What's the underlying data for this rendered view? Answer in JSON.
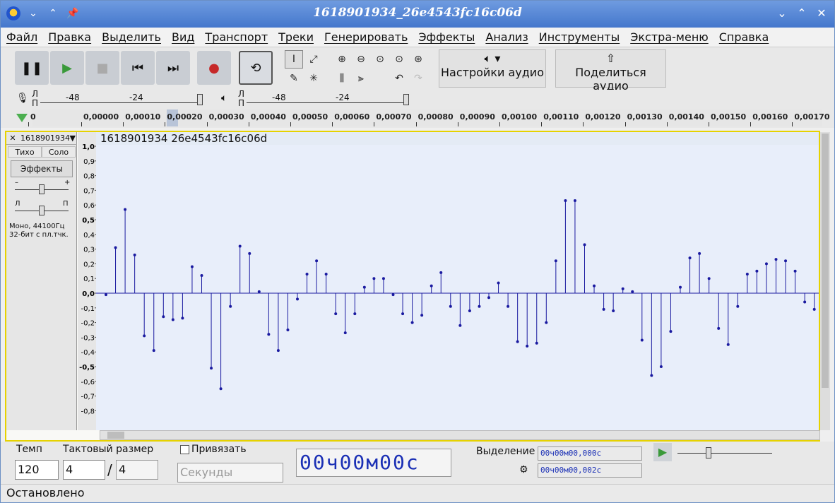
{
  "window": {
    "title": "1618901934_26e4543fc16c06d",
    "titlebar_icons": [
      "⌄",
      "⌃",
      "📌"
    ],
    "controls": [
      "⌄",
      "⌃",
      "✕"
    ]
  },
  "menu": [
    "Файл",
    "Правка",
    "Выделить",
    "Вид",
    "Транспорт",
    "Треки",
    "Генерировать",
    "Эффекты",
    "Анализ",
    "Инструменты",
    "Экстра-меню",
    "Справка"
  ],
  "toolbar": {
    "audio_setup_label": "Настройки аудио",
    "share_label": "Поделиться аудио"
  },
  "meters": {
    "rec_lr": [
      "Л",
      "П"
    ],
    "play_lr": [
      "Л",
      "П"
    ],
    "ticks": [
      "-48",
      "-24"
    ]
  },
  "ruler": {
    "ticks": [
      "0",
      "0,00000",
      "0,00010",
      "0,00020",
      "0,00030",
      "0,00040",
      "0,00050",
      "0,00060",
      "0,00070",
      "0,00080",
      "0,00090",
      "0,00100",
      "0,00110",
      "0,00120",
      "0,00130",
      "0,00140",
      "0,00150",
      "0,00160",
      "0,00170"
    ]
  },
  "track": {
    "name": "1618901934",
    "mute": "Тихо",
    "solo": "Соло",
    "effects": "Эффекты",
    "gain_minus": "–",
    "gain_plus": "+",
    "pan_left": "Л",
    "pan_right": "П",
    "info_line1": "Моно, 44100Гц",
    "info_line2": "32-бит с пл.тчк.",
    "clip_name": "1618901934  26e4543fc16c06d"
  },
  "chart_data": {
    "type": "scatter",
    "style": "stem",
    "ylim": [
      -1.0,
      1.0
    ],
    "yticks": [
      "1,0",
      "0,9",
      "0,8",
      "0,7",
      "0,6",
      "0,5",
      "0,4",
      "0,3",
      "0,2",
      "0,1",
      "0,0",
      "-0,1",
      "-0,2",
      "-0,3",
      "-0,4",
      "-0,5",
      "-0,6",
      "-0,7",
      "-0,8"
    ],
    "values": [
      -0.01,
      0.31,
      0.57,
      0.26,
      -0.29,
      -0.39,
      -0.16,
      -0.18,
      -0.17,
      0.18,
      0.12,
      -0.51,
      -0.65,
      -0.09,
      0.32,
      0.27,
      0.01,
      -0.28,
      -0.39,
      -0.25,
      -0.04,
      0.13,
      0.22,
      0.13,
      -0.14,
      -0.27,
      -0.14,
      0.04,
      0.1,
      0.1,
      -0.01,
      -0.14,
      -0.2,
      -0.15,
      0.05,
      0.14,
      -0.09,
      -0.22,
      -0.12,
      -0.09,
      -0.03,
      0.07,
      -0.09,
      -0.33,
      -0.36,
      -0.34,
      -0.2,
      0.22,
      0.63,
      0.63,
      0.33,
      0.05,
      -0.11,
      -0.12,
      0.03,
      0.01,
      -0.32,
      -0.56,
      -0.5,
      -0.26,
      0.04,
      0.24,
      0.27,
      0.1,
      -0.24,
      -0.35,
      -0.09,
      0.13,
      0.15,
      0.2,
      0.23,
      0.22,
      0.15,
      -0.06,
      -0.11,
      0.17
    ],
    "color": "#1a1aa0"
  },
  "bottom": {
    "tempo_label": "Темп",
    "tempo_value": "120",
    "timesig_label": "Тактовый размер",
    "timesig_num": "4",
    "timesig_slash": "/",
    "timesig_den": "4",
    "snap_label": "Привязать",
    "snap_unit": "Секунды",
    "time_display": "00ч00м00с",
    "selection_label": "Выделение",
    "sel_start": "00ч00м00,000с",
    "sel_end": "00ч00м00,002с"
  },
  "status": "Остановлено"
}
